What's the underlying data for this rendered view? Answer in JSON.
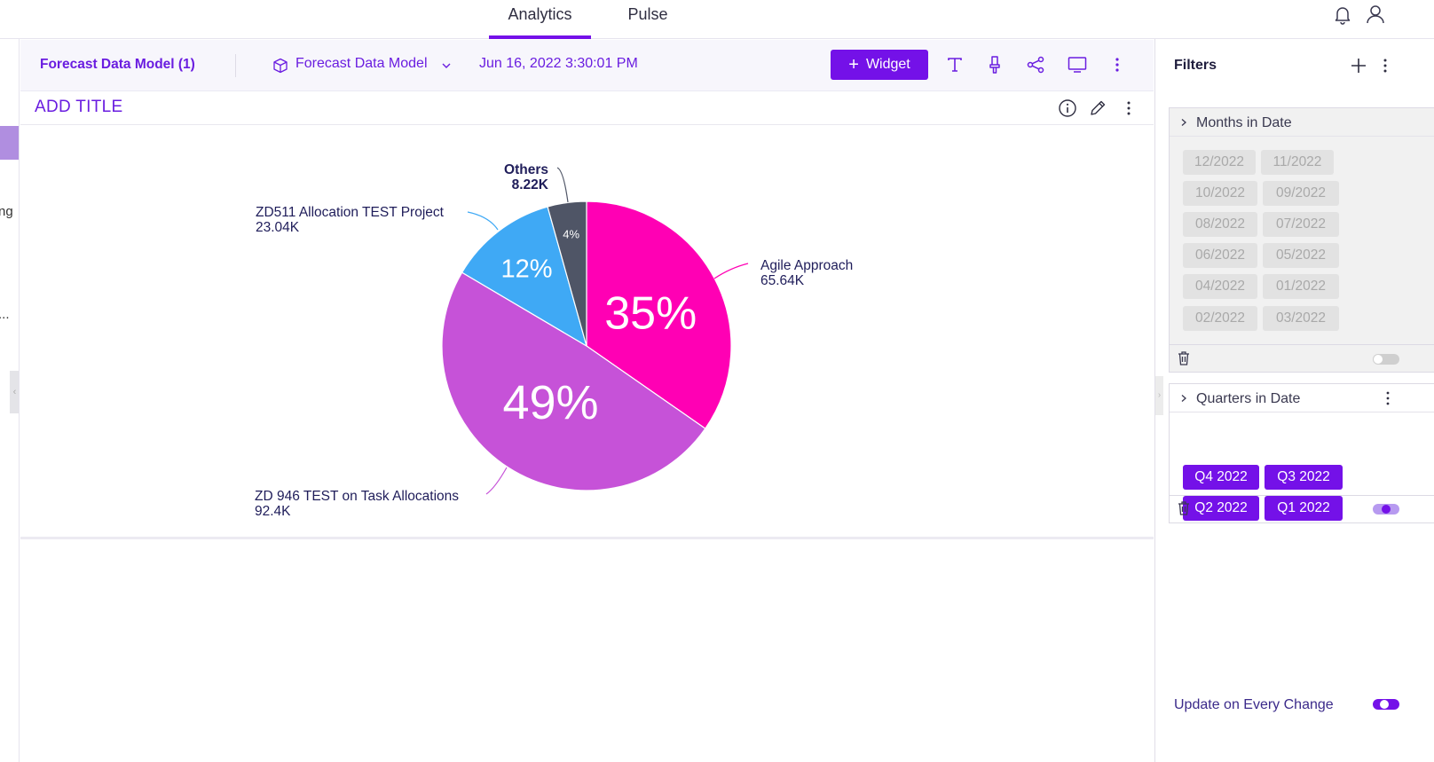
{
  "nav": {
    "tabs": [
      {
        "label": "Analytics",
        "active": true
      },
      {
        "label": "Pulse",
        "active": false
      }
    ],
    "icons": [
      "bell-icon",
      "user-icon"
    ]
  },
  "left_strip": {
    "fragments": [
      "ng",
      "..."
    ]
  },
  "toolbar": {
    "dashboard_title": "Forecast Data Model (1)",
    "datasource_label": "Forecast Data Model",
    "timestamp": "Jun 16, 2022 3:30:01 PM",
    "widget_button": "Widget",
    "accent_color": "#7411e8"
  },
  "widget": {
    "title": "ADD TITLE",
    "chart_data": {
      "type": "pie",
      "slices": [
        {
          "name": "Agile Approach",
          "value_label": "65.64K",
          "value": 65640,
          "percent_label": "35%",
          "percent": 35,
          "color": "#ff00b4"
        },
        {
          "name": "ZD 946 TEST on Task Allocations",
          "value_label": "92.4K",
          "value": 92400,
          "percent_label": "49%",
          "percent": 49,
          "color": "#c652d8"
        },
        {
          "name": "ZD511 Allocation TEST Project",
          "value_label": "23.04K",
          "value": 23040,
          "percent_label": "12%",
          "percent": 12,
          "color": "#3fa9f5"
        },
        {
          "name": "Others",
          "value_label": "8.22K",
          "value": 8220,
          "percent_label": "4%",
          "percent": 4,
          "color": "#4f5566"
        }
      ]
    }
  },
  "filters": {
    "title": "Filters",
    "cards": [
      {
        "title": "Months in Date",
        "chips": [
          "12/2022",
          "11/2022",
          "10/2022",
          "09/2022",
          "08/2022",
          "07/2022",
          "06/2022",
          "05/2022",
          "04/2022",
          "01/2022",
          "02/2022",
          "03/2022"
        ],
        "enabled": false
      },
      {
        "title": "Quarters in Date",
        "chips": [
          "Q4 2022",
          "Q3 2022",
          "Q2 2022",
          "Q1 2022"
        ],
        "enabled": true
      }
    ],
    "update_label": "Update on Every Change",
    "update_enabled": true
  }
}
